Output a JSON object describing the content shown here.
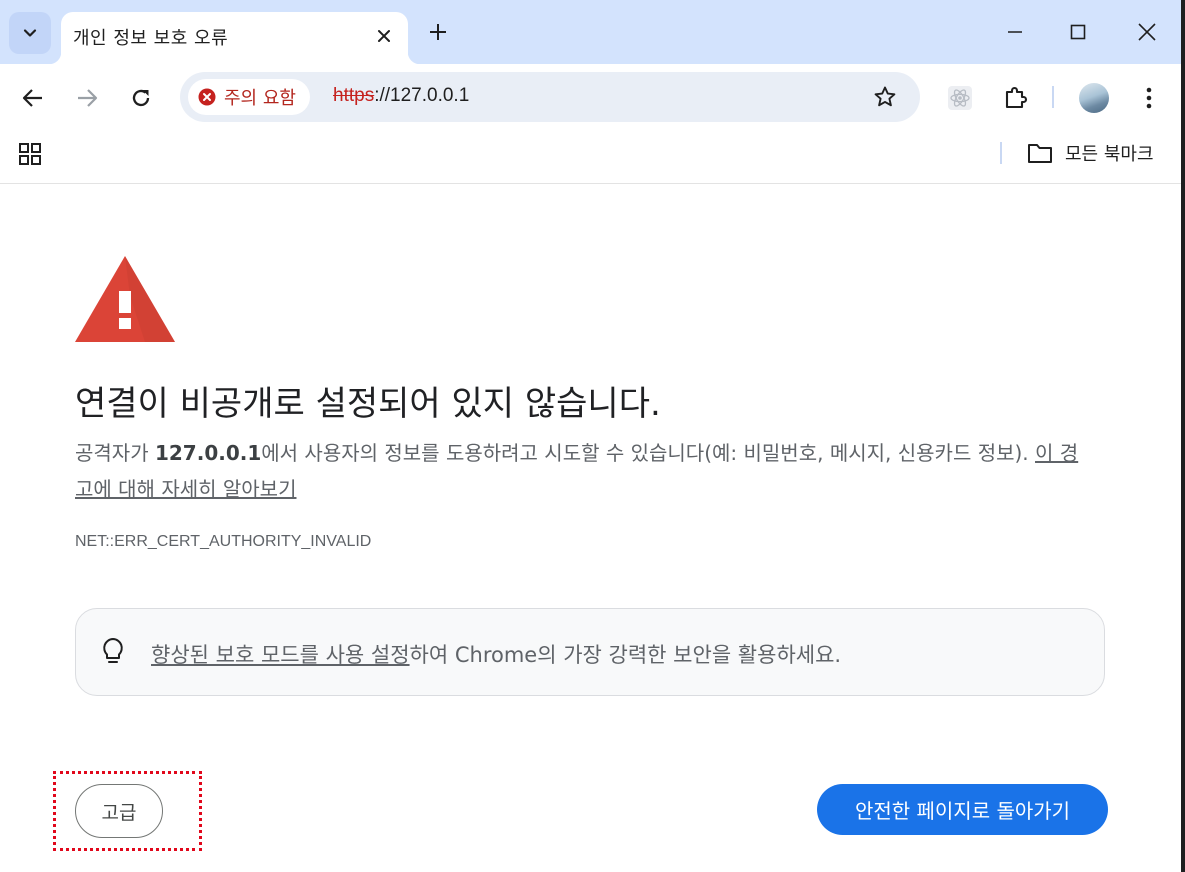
{
  "browser": {
    "tab": {
      "title": "개인 정보 보호 오류"
    },
    "omnibox": {
      "security_label": "주의 요함",
      "url_scheme": "https",
      "url_rest": "://127.0.0.1"
    },
    "bookmarks_bar": {
      "all_bookmarks_label": "모든 북마크"
    }
  },
  "page": {
    "headline": "연결이 비공개로 설정되어 있지 않습니다.",
    "desc_prefix": "공격자가 ",
    "desc_host": "127.0.0.1",
    "desc_suffix": "에서 사용자의 정보를 도용하려고 시도할 수 있습니다(예: 비밀번호, 메시지, 신용카드 정보). ",
    "learn_more_link": "이 경고에 대해 자세히 알아보기",
    "error_code": "NET::ERR_CERT_AUTHORITY_INVALID",
    "promo_link": "향상된 보호 모드를 사용 설정",
    "promo_suffix": "하여 Chrome의 가장 강력한 보안을 활용하세요.",
    "advanced_button": "고급",
    "back_to_safety_button": "안전한 페이지로 돌아가기"
  },
  "colors": {
    "tabstrip": "#d3e3fd",
    "warning_red": "#db4437",
    "primary_button": "#1a73e8",
    "highlight_outline": "#e1071b"
  }
}
